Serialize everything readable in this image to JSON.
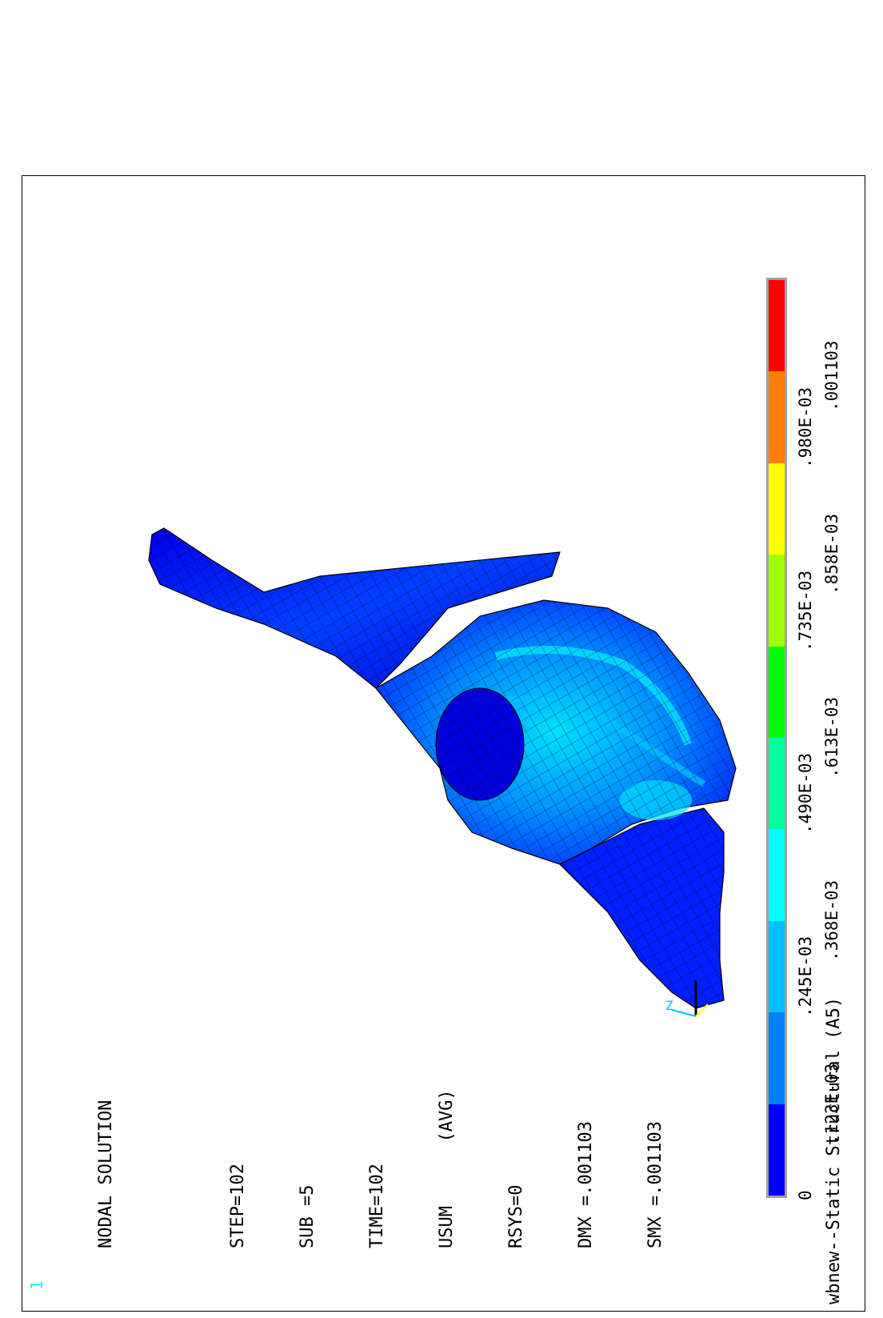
{
  "window": {
    "number": "1"
  },
  "solution_info": {
    "title": "NODAL SOLUTION",
    "lines": [
      "STEP=102",
      "SUB =5",
      "TIME=102",
      "USUM      (AVG)",
      "RSYS=0",
      "DMX =.001103",
      "SMX =.001103"
    ]
  },
  "footer": {
    "title": "wbnew--Static Structural (A5)"
  },
  "legend": {
    "bottom_labels": [
      "0",
      ".245E-03",
      ".490E-03",
      ".735E-03",
      ".980E-03"
    ],
    "top_labels": [
      ".123E-03",
      ".368E-03",
      ".613E-03",
      ".858E-03",
      ".001103"
    ],
    "colors": [
      "#0000ff",
      "#0080ff",
      "#00c0ff",
      "#00ffff",
      "#00ff9f",
      "#00ff00",
      "#a0ff00",
      "#ffff00",
      "#ff8000",
      "#ff0000"
    ]
  },
  "triad": {
    "axis_label": "Z"
  },
  "colors": {
    "mesh_dark": "#0000cc",
    "mesh_mid": "#0050ff",
    "mesh_light": "#00b8ff",
    "edge": "#000000"
  }
}
